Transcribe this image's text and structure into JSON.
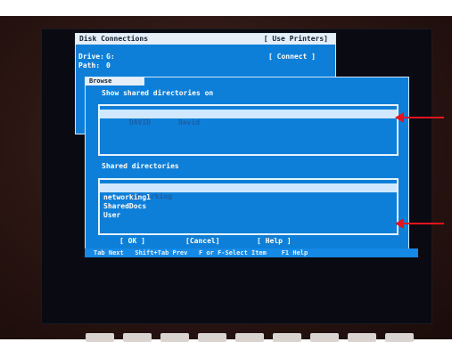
{
  "disk_window": {
    "title": "Disk Connections",
    "printers_button": "[ Use Printers]",
    "drive_label": "Drive:",
    "drive_value": "G:",
    "path_label": "Path:",
    "path_value": "0",
    "connect_button": "[ Connect ]"
  },
  "browse_dialog": {
    "title": "Browse",
    "computers_heading": "Show shared directories on",
    "computers": [
      {
        "name": "DAVID",
        "comment": "David"
      }
    ],
    "shares_heading": "Shared directories",
    "shares": [
      "networking",
      "networking1",
      "SharedDocs",
      "User"
    ],
    "ok_button": "[ OK ]",
    "cancel_button": "[Cancel]",
    "help_button": "[ Help ]"
  },
  "status_bar": {
    "text": "Tab Next   Shift+Tab Prev   F or F-Select Item    F1 Help"
  },
  "colors": {
    "dialog_blue": "#0e7fd8",
    "highlight": "#cfe8ff",
    "annotation_arrow": "#e3141c"
  }
}
